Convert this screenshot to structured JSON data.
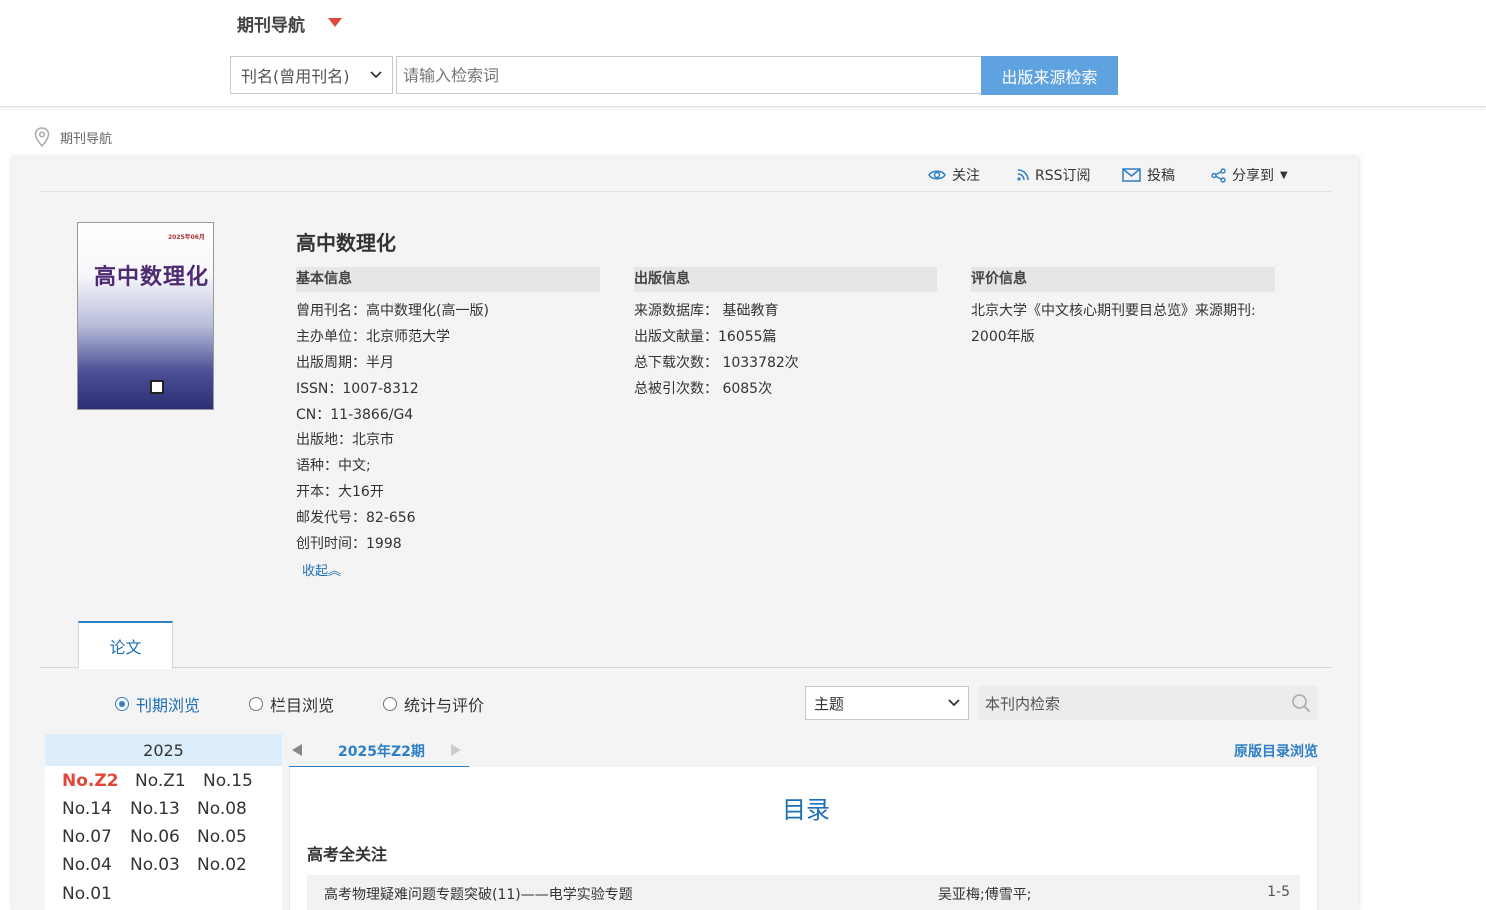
{
  "header": {
    "nav_title": "期刊导航",
    "search_field_select": "刊名(曾用刊名)",
    "search_placeholder": "请输入检索词",
    "search_button": "出版来源检索"
  },
  "breadcrumb": {
    "label": "期刊导航"
  },
  "toolbar": {
    "follow": "关注",
    "rss": "RSS订阅",
    "submit": "投稿",
    "share": "分享到"
  },
  "journal": {
    "name": "高中数理化",
    "cover_title": "高中数理化",
    "cover_issue": "2025年06月"
  },
  "basic_info": {
    "heading": "基本信息",
    "items": [
      {
        "label": "曾用刊名：",
        "value": "高中数理化(高一版)"
      },
      {
        "label": "主办单位：",
        "value": "北京师范大学"
      },
      {
        "label": "出版周期：",
        "value": "半月"
      },
      {
        "label": "ISSN：",
        "value": "1007-8312"
      },
      {
        "label": "CN：",
        "value": "11-3866/G4"
      },
      {
        "label": "出版地：",
        "value": "北京市"
      },
      {
        "label": "语种：",
        "value": "中文;"
      },
      {
        "label": "开本：",
        "value": "大16开"
      },
      {
        "label": "邮发代号：",
        "value": "82-656"
      },
      {
        "label": "创刊时间：",
        "value": "1998"
      }
    ],
    "collapse": "收起︽"
  },
  "publish_info": {
    "heading": "出版信息",
    "items": [
      {
        "label": "来源数据库：",
        "value": "基础教育"
      },
      {
        "label": "出版文献量：",
        "value": "16055篇"
      },
      {
        "label": "总下载次数：",
        "value": "1033782次"
      },
      {
        "label": "总被引次数：",
        "value": "6085次"
      }
    ]
  },
  "eval_info": {
    "heading": "评价信息",
    "line1": "北京大学《中文核心期刊要目总览》来源期刊:",
    "line2": "2000年版"
  },
  "tabs": {
    "papers": "论文"
  },
  "browse": {
    "options": [
      "刊期浏览",
      "栏目浏览",
      "统计与评价"
    ],
    "selected_index": 0,
    "topic_select": "主题",
    "inner_search_placeholder": "本刊内检索"
  },
  "year_panel": {
    "year": "2025",
    "issues": [
      "No.Z2",
      "No.Z1",
      "No.15",
      "No.14",
      "No.13",
      "No.08",
      "No.07",
      "No.06",
      "No.05",
      "No.04",
      "No.03",
      "No.02",
      "No.01"
    ],
    "current": "No.Z2"
  },
  "issue_view": {
    "tab": "2025年Z2期",
    "orig_link": "原版目录浏览",
    "toc_title": "目录",
    "section": "高考全关注",
    "articles": [
      {
        "title": "高考物理疑难问题专题突破(11)——电学实验专题",
        "authors": "吴亚梅;傅雪平;",
        "pages": "1-5"
      }
    ]
  },
  "colors": {
    "accent": "#2e7fc6",
    "button": "#5ea3e0",
    "highlight": "#e0483a"
  }
}
